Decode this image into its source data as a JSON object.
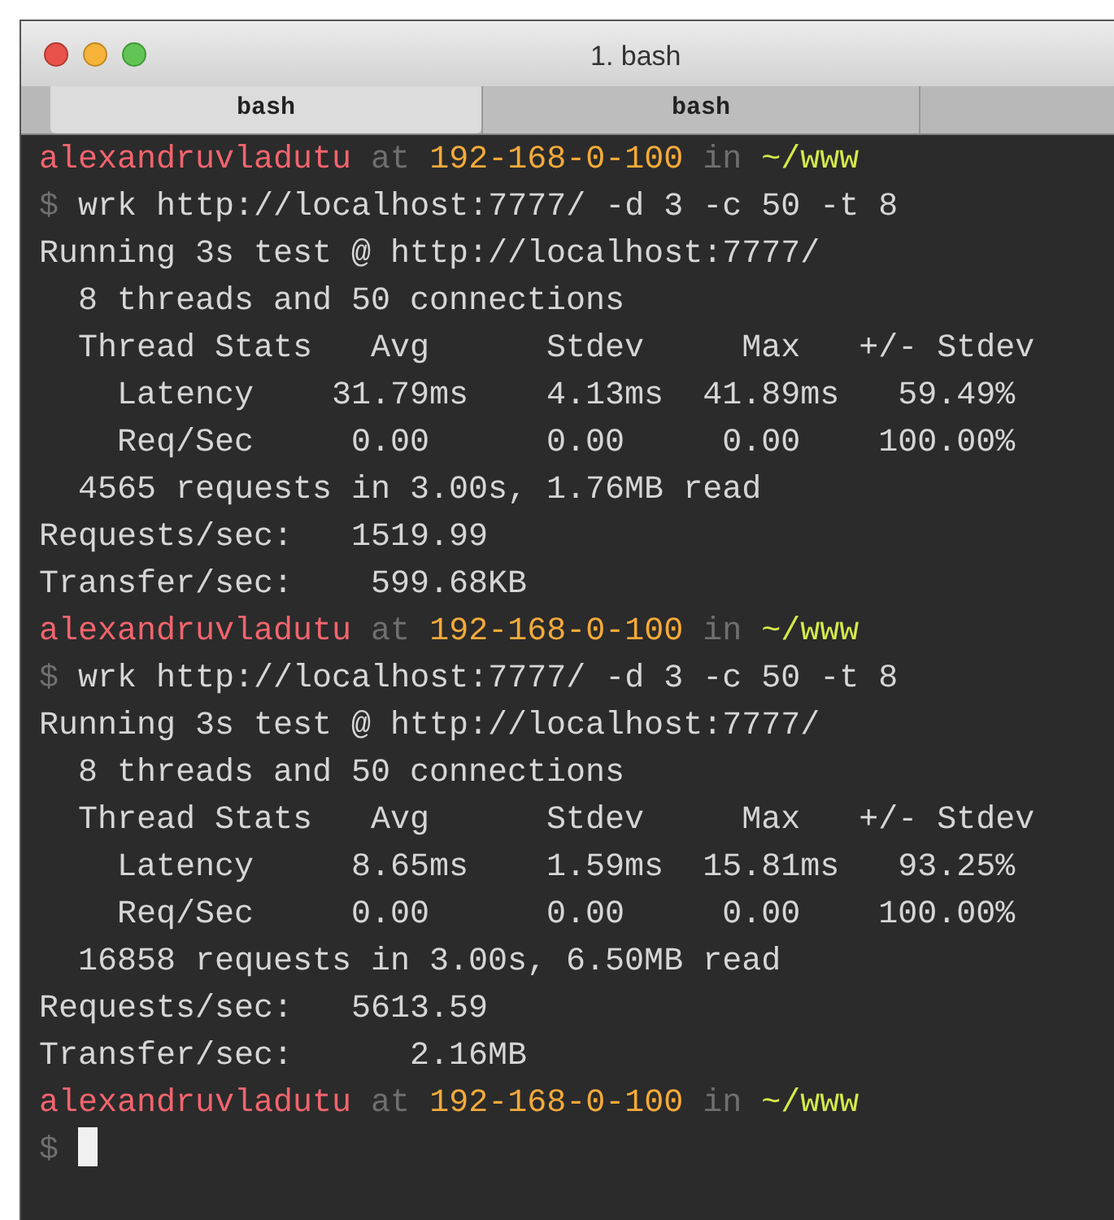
{
  "window": {
    "title": "1. bash"
  },
  "tabs": [
    {
      "label": "bash",
      "selected": true
    },
    {
      "label": "bash",
      "selected": false
    }
  ],
  "lines": [
    {
      "kind": "prompt",
      "user": "alexandruvladutu",
      "at": "at",
      "host": "192-168-0-100",
      "in": "in",
      "path": "~/www"
    },
    {
      "kind": "command",
      "sign": "$",
      "text": "wrk http://localhost:7777/ -d 3 -c 50 -t 8"
    },
    {
      "kind": "output",
      "text": "Running 3s test @ http://localhost:7777/"
    },
    {
      "kind": "output",
      "text": "  8 threads and 50 connections"
    },
    {
      "kind": "output",
      "text": "  Thread Stats   Avg      Stdev     Max   +/- Stdev"
    },
    {
      "kind": "output",
      "text": "    Latency    31.79ms    4.13ms  41.89ms   59.49%"
    },
    {
      "kind": "output",
      "text": "    Req/Sec     0.00      0.00     0.00    100.00%"
    },
    {
      "kind": "output",
      "text": "  4565 requests in 3.00s, 1.76MB read"
    },
    {
      "kind": "output",
      "text": "Requests/sec:   1519.99"
    },
    {
      "kind": "output",
      "text": "Transfer/sec:    599.68KB"
    },
    {
      "kind": "prompt",
      "user": "alexandruvladutu",
      "at": "at",
      "host": "192-168-0-100",
      "in": "in",
      "path": "~/www"
    },
    {
      "kind": "command",
      "sign": "$",
      "text": "wrk http://localhost:7777/ -d 3 -c 50 -t 8"
    },
    {
      "kind": "output",
      "text": "Running 3s test @ http://localhost:7777/"
    },
    {
      "kind": "output",
      "text": "  8 threads and 50 connections"
    },
    {
      "kind": "output",
      "text": "  Thread Stats   Avg      Stdev     Max   +/- Stdev"
    },
    {
      "kind": "output",
      "text": "    Latency     8.65ms    1.59ms  15.81ms   93.25%"
    },
    {
      "kind": "output",
      "text": "    Req/Sec     0.00      0.00     0.00    100.00%"
    },
    {
      "kind": "output",
      "text": "  16858 requests in 3.00s, 6.50MB read"
    },
    {
      "kind": "output",
      "text": "Requests/sec:   5613.59"
    },
    {
      "kind": "output",
      "text": "Transfer/sec:      2.16MB"
    },
    {
      "kind": "prompt",
      "user": "alexandruvladutu",
      "at": "at",
      "host": "192-168-0-100",
      "in": "in",
      "path": "~/www"
    },
    {
      "kind": "input",
      "sign": "$"
    }
  ]
}
